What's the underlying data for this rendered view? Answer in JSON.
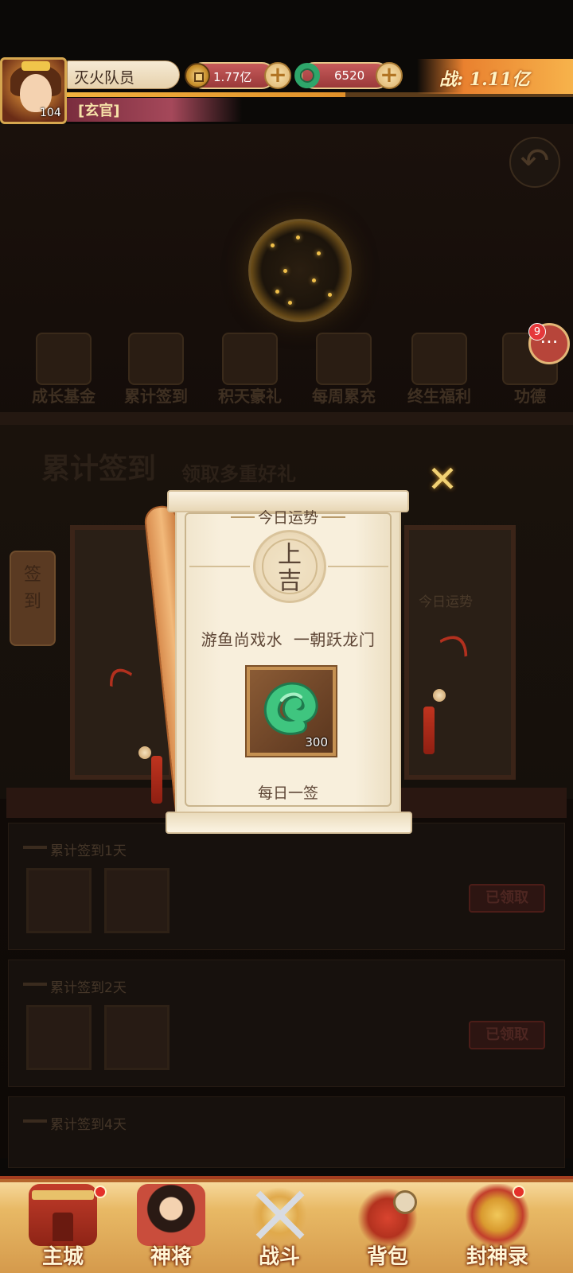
{
  "player": {
    "name": "灭火队员",
    "level": "104",
    "title": "[玄官]",
    "power": "战: 1.11亿",
    "xp_progress": 0.55
  },
  "currencies": {
    "coins": "1.77亿",
    "jade": "6520"
  },
  "chat": {
    "badge": "9"
  },
  "activity_tabs": [
    {
      "label": "成长基金"
    },
    {
      "label": "累计签到"
    },
    {
      "label": "积天豪礼"
    },
    {
      "label": "每周累充"
    },
    {
      "label": "终生福利"
    },
    {
      "label": "功德"
    }
  ],
  "signin_banner": {
    "title": "累计签到",
    "subtitle": "领取多重好礼",
    "side_label": "签到",
    "fortune_label": "今日运势"
  },
  "signin_list": [
    {
      "title": "累计签到1天",
      "status": "已领取"
    },
    {
      "title": "累计签到2天",
      "status": "已领取"
    },
    {
      "title": "累计签到4天",
      "status": ""
    }
  ],
  "fortune_modal": {
    "header": "今日运势",
    "fortune_line1": "上",
    "fortune_line2": "吉",
    "verse": "游鱼尚戏水  一朝跃龙门",
    "reward_qty": "300",
    "footer": "每日一签",
    "close_symbol": "✕"
  },
  "bottom_nav": [
    {
      "label": "主城",
      "has_dot": true
    },
    {
      "label": "神将",
      "has_dot": false
    },
    {
      "label": "战斗",
      "has_dot": false
    },
    {
      "label": "背包",
      "has_dot": false
    },
    {
      "label": "封神录",
      "has_dot": true
    }
  ],
  "colors": {
    "accent_gold": "#f1d174",
    "scroll_paper": "#f8efdc",
    "jade_green": "#2ea66a",
    "nav_bg": "#e8b965"
  }
}
